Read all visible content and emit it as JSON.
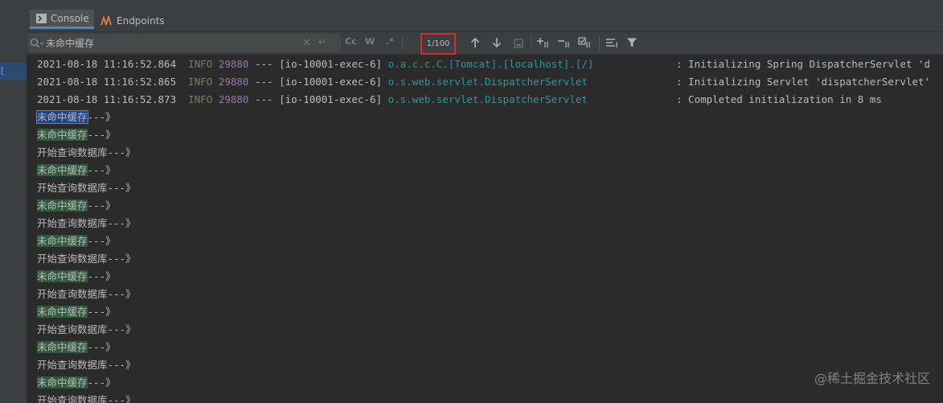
{
  "tabs": [
    {
      "label": "Console",
      "icon": "console-icon",
      "active": true
    },
    {
      "label": "Endpoints",
      "icon": "endpoints-icon",
      "active": false
    }
  ],
  "search": {
    "value": "未命中缓存",
    "options": {
      "match_case": "Cc",
      "words": "W",
      "regex": ".*"
    },
    "match_counter": "1/100"
  },
  "left_panel": {
    "selected_text": "l"
  },
  "log": [
    {
      "date": "2021-08-18",
      "time": "11:16:52.864",
      "level": "INFO",
      "pid": "29880",
      "sep": "---",
      "thread": "[io-10001-exec-6]",
      "logger": "o.a.c.c.C.[Tomcat].[localhost].[/]",
      "message": ": Initializing Spring DispatcherServlet 'd"
    },
    {
      "date": "2021-08-18",
      "time": "11:16:52.865",
      "level": "INFO",
      "pid": "29880",
      "sep": "---",
      "thread": "[io-10001-exec-6]",
      "logger": "o.s.web.servlet.DispatcherServlet",
      "message": ": Initializing Servlet 'dispatcherServlet'"
    },
    {
      "date": "2021-08-18",
      "time": "11:16:52.873",
      "level": "INFO",
      "pid": "29880",
      "sep": "---",
      "thread": "[io-10001-exec-6]",
      "logger": "o.s.web.servlet.DispatcherServlet",
      "message": ": Completed initialization in 8 ms"
    }
  ],
  "output": [
    {
      "match": "未命中缓存",
      "rest": "---》",
      "current": true
    },
    {
      "match": "未命中缓存",
      "rest": "---》"
    },
    {
      "match": "",
      "rest": "开始查询数据库---》"
    },
    {
      "match": "未命中缓存",
      "rest": "---》"
    },
    {
      "match": "",
      "rest": "开始查询数据库---》"
    },
    {
      "match": "未命中缓存",
      "rest": "---》"
    },
    {
      "match": "",
      "rest": "开始查询数据库---》"
    },
    {
      "match": "未命中缓存",
      "rest": "---》"
    },
    {
      "match": "",
      "rest": "开始查询数据库---》"
    },
    {
      "match": "未命中缓存",
      "rest": "---》"
    },
    {
      "match": "",
      "rest": "开始查询数据库---》"
    },
    {
      "match": "未命中缓存",
      "rest": "---》"
    },
    {
      "match": "",
      "rest": "开始查询数据库---》"
    },
    {
      "match": "未命中缓存",
      "rest": "---》"
    },
    {
      "match": "",
      "rest": "开始查询数据库---》"
    },
    {
      "match": "未命中缓存",
      "rest": "---》"
    },
    {
      "match": "",
      "rest": "开始查询数据库---》"
    }
  ],
  "watermark": "@稀土掘金技术社区",
  "colors": {
    "highlight": "#32593d",
    "current_highlight": "#214283",
    "counter_border": "#e0262a",
    "info": "#6a8759",
    "pid": "#9876aa",
    "logger": "#299999"
  }
}
